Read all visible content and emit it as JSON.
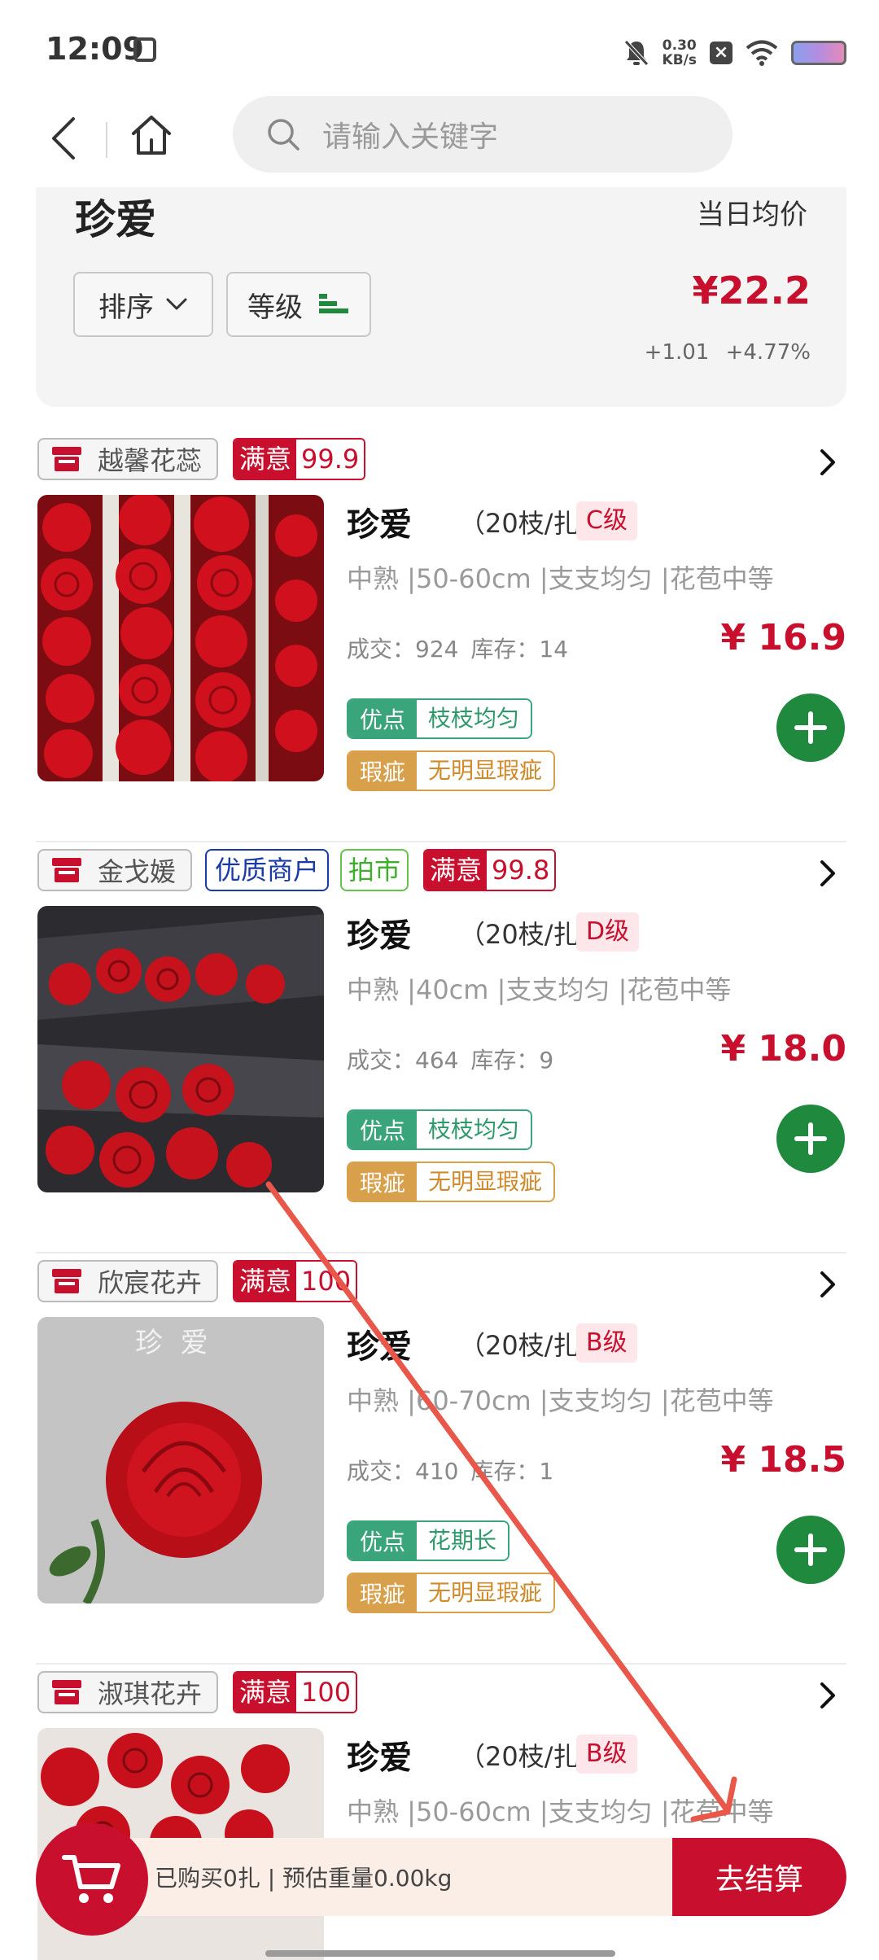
{
  "status_bar": {
    "time": "12:09",
    "net_speed_value": "0.30",
    "net_speed_unit": "KB/s"
  },
  "header": {
    "search_placeholder": "请输入关键字"
  },
  "summary": {
    "title": "珍爱",
    "avg_label": "当日均价",
    "sort_label": "排序",
    "grade_label": "等级",
    "price": "¥22.2",
    "change_abs": "+1.01",
    "change_pct": "+4.77%"
  },
  "products": [
    {
      "shop": "越馨花蕊",
      "badges": [],
      "satisfaction_label": "满意",
      "satisfaction": "99.9",
      "name": "珍爱",
      "spec": "（20枝/扎）",
      "grade": "C级",
      "desc": "中熟 |50-60cm |支支均匀 |花苞中等",
      "deal_label": "成交：",
      "deal": "924",
      "stock_label": "库存：",
      "stock": "14",
      "price": "¥ 16.9",
      "good_label": "优点",
      "good": "枝枝均匀",
      "bad_label": "瑕疵",
      "bad": "无明显瑕疵"
    },
    {
      "shop": "金戈媛",
      "badges": [
        "优质商户",
        "拍市"
      ],
      "satisfaction_label": "满意",
      "satisfaction": "99.8",
      "name": "珍爱",
      "spec": "（20枝/扎）",
      "grade": "D级",
      "desc": "中熟 |40cm |支支均匀 |花苞中等",
      "deal_label": "成交：",
      "deal": "464",
      "stock_label": "库存：",
      "stock": "9",
      "price": "¥ 18.0",
      "good_label": "优点",
      "good": "枝枝均匀",
      "bad_label": "瑕疵",
      "bad": "无明显瑕疵"
    },
    {
      "shop": "欣宸花卉",
      "badges": [],
      "satisfaction_label": "满意",
      "satisfaction": "100",
      "name": "珍爱",
      "spec": "（20枝/扎）",
      "grade": "B级",
      "desc": "中熟 |60-70cm |支支均匀 |花苞中等",
      "deal_label": "成交：",
      "deal": "410",
      "stock_label": "库存：",
      "stock": "1",
      "price": "¥ 18.5",
      "good_label": "优点",
      "good": "花期长",
      "bad_label": "瑕疵",
      "bad": "无明显瑕疵",
      "image_caption": "珍  爱"
    },
    {
      "shop": "淑琪花卉",
      "badges": [],
      "satisfaction_label": "满意",
      "satisfaction": "100",
      "name": "珍爱",
      "spec": "（20枝/扎）",
      "grade": "B级",
      "desc": "中熟 |50-60cm |支支均匀 |花苞中等"
    }
  ],
  "bottom_bar": {
    "summary": "已购买0扎 | 预估重量0.00kg",
    "checkout": "去结算"
  },
  "colors": {
    "brand_red": "#c8102e",
    "add_green": "#1f8a3e",
    "good_green": "#3aa57a",
    "bad_orange": "#d9a04c",
    "annotation_arrow": "#e8574a"
  }
}
